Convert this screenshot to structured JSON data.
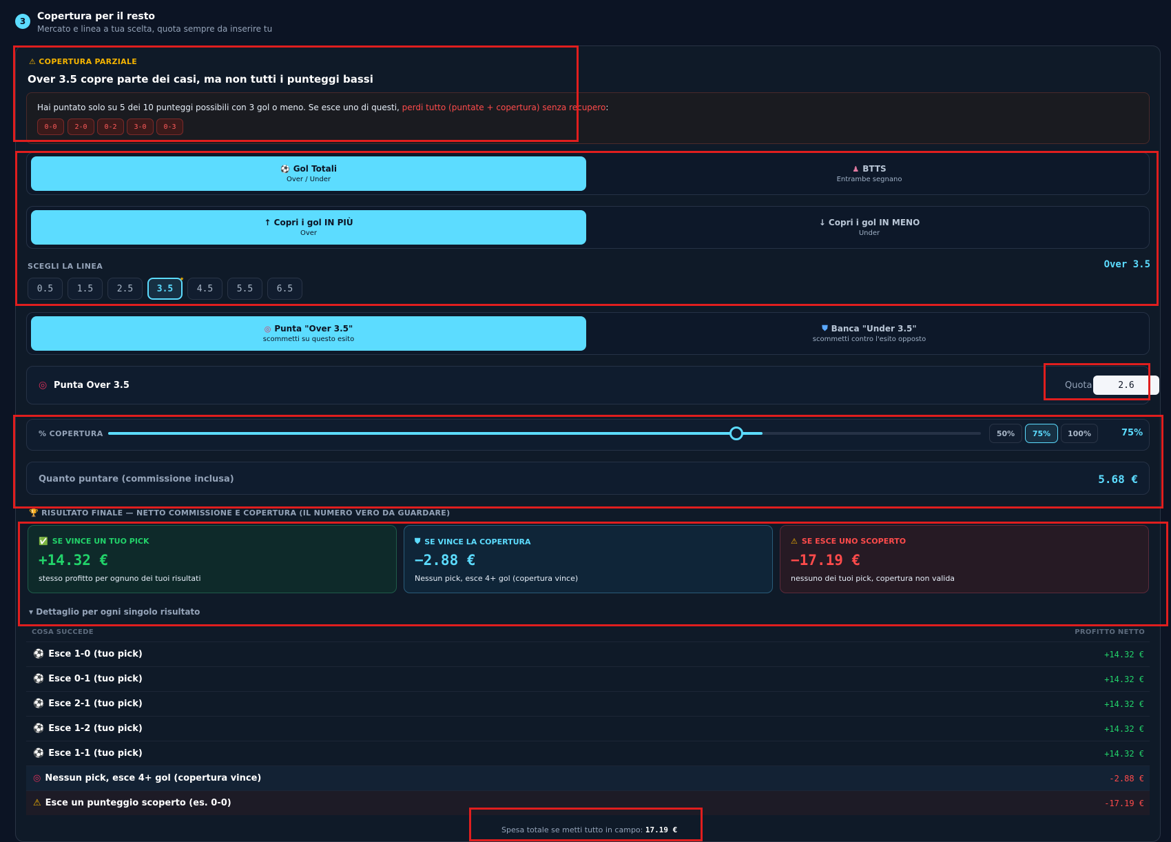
{
  "section": {
    "number": "3",
    "title": "Copertura per il resto",
    "subtitle": "Mercato e linea a tua scelta, quota sempre da inserire tu"
  },
  "warning": {
    "tag": "COPERTURA PARZIALE",
    "title": "Over 3.5 copre parte dei casi, ma non tutti i punteggi bassi",
    "text_plain": "Hai puntato solo su 5 dei 10 punteggi possibili con 3 gol o meno. Se esce uno di questi,",
    "text_red": "perdi tutto (puntate + copertura) senza recupero",
    "text_end": ":",
    "chips": [
      "0-0",
      "2-0",
      "0-2",
      "3-0",
      "0-3"
    ]
  },
  "market": {
    "active": {
      "label": "Gol Totali",
      "sub": "Over / Under",
      "icon": "soccer-ball-icon"
    },
    "inactive": {
      "label": "BTTS",
      "sub": "Entrambe segnano",
      "icon": "people-icon"
    }
  },
  "direction": {
    "active": {
      "label": "↑ Copri i gol IN PIÙ",
      "sub": "Over"
    },
    "inactive": {
      "label": "↓ Copri i gol IN MENO",
      "sub": "Under"
    }
  },
  "line": {
    "label": "SCEGLI LA LINEA",
    "selected_display": "Over 3.5",
    "options": [
      "0.5",
      "1.5",
      "2.5",
      "3.5",
      "4.5",
      "5.5",
      "6.5"
    ],
    "selected": "3.5"
  },
  "bet_type": {
    "active": {
      "label": "Punta \"Over 3.5\"",
      "sub": "scommetti su questo esito",
      "icon": "target-icon"
    },
    "inactive": {
      "label": "Banca \"Under 3.5\"",
      "sub": "scommetti contro l'esito opposto",
      "icon": "shield-icon"
    }
  },
  "punta": {
    "label": "Punta Over 3.5",
    "quota_label": "Quota",
    "quota_value": "2.6"
  },
  "coverage": {
    "label": "% COPERTURA",
    "value": 0.72,
    "presets": [
      "50%",
      "75%",
      "100%"
    ],
    "selected_preset": "75%",
    "display": "75%"
  },
  "stake": {
    "label": "Quanto puntare (commissione inclusa)",
    "value": "5.68 €"
  },
  "result": {
    "title": "RISULTATO FINALE — NETTO COMMISSIONE E COPERTURA (IL NUMERO VERO DA GUARDARE)",
    "cards": [
      {
        "title": "SE VINCE UN TUO PICK",
        "value": "+14.32 €",
        "desc": "stesso profitto per ognuno dei tuoi risultati"
      },
      {
        "title": "SE VINCE LA COPERTURA",
        "value": "−2.88 €",
        "desc": "Nessun pick, esce 4+ gol (copertura vince)"
      },
      {
        "title": "SE ESCE UNO SCOPERTO",
        "value": "−17.19 €",
        "desc": "nessuno dei tuoi pick, copertura non valida"
      }
    ]
  },
  "detail": {
    "toggle": "Dettaglio per ogni singolo risultato",
    "col_left": "COSA SUCCEDE",
    "col_right": "PROFITTO NETTO",
    "rows": [
      {
        "label": "Esce 1-0 (tuo pick)",
        "profit": "+14.32 €"
      },
      {
        "label": "Esce 0-1 (tuo pick)",
        "profit": "+14.32 €"
      },
      {
        "label": "Esce 2-1 (tuo pick)",
        "profit": "+14.32 €"
      },
      {
        "label": "Esce 1-2 (tuo pick)",
        "profit": "+14.32 €"
      },
      {
        "label": "Esce 1-1 (tuo pick)",
        "profit": "+14.32 €"
      },
      {
        "label": "Nessun pick, esce 4+ gol (copertura vince)",
        "profit": "-2.88 €"
      },
      {
        "label": "Esce un punteggio scoperto (es. 0-0)",
        "profit": "-17.19 €"
      }
    ]
  },
  "footer": {
    "text": "Spesa totale se metti tutto in campo:",
    "value": "17.19 €"
  },
  "colors": {
    "accent": "#5cdcff",
    "green": "#22d36a",
    "red": "#ff4b4b",
    "warn": "#f5b400",
    "background": "#0c1424"
  }
}
